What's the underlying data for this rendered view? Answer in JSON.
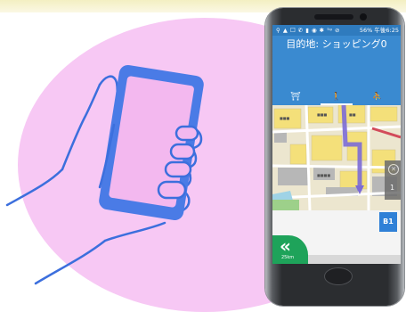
{
  "status_bar": {
    "icons": "⚲ ▲ ☐ ✆ ▮ ◉ ✱ ⁵ᵍ ⊘",
    "battery": "56%",
    "time": "午後6:25"
  },
  "destination_label": "目的地: ショッピング0",
  "tabs": [
    {
      "label": "⛩",
      "active": false
    },
    {
      "label": "🚶",
      "active": true
    },
    {
      "label": "⛹",
      "active": false
    }
  ],
  "map": {
    "zoom_level": "1",
    "route_color": "#7c6bd6",
    "water_color": "#9fd3e6"
  },
  "floor_button": "B1",
  "back_button": {
    "icon": "double-chevron-left-icon",
    "label": "25km"
  },
  "colors": {
    "blob": "#f7c8f4",
    "hand_outline": "#3c6fdd",
    "phone_screen_illustration": "#4a7be6",
    "header": "#3a8ad0",
    "back": "#1ea35a",
    "floor": "#2f80d7"
  }
}
